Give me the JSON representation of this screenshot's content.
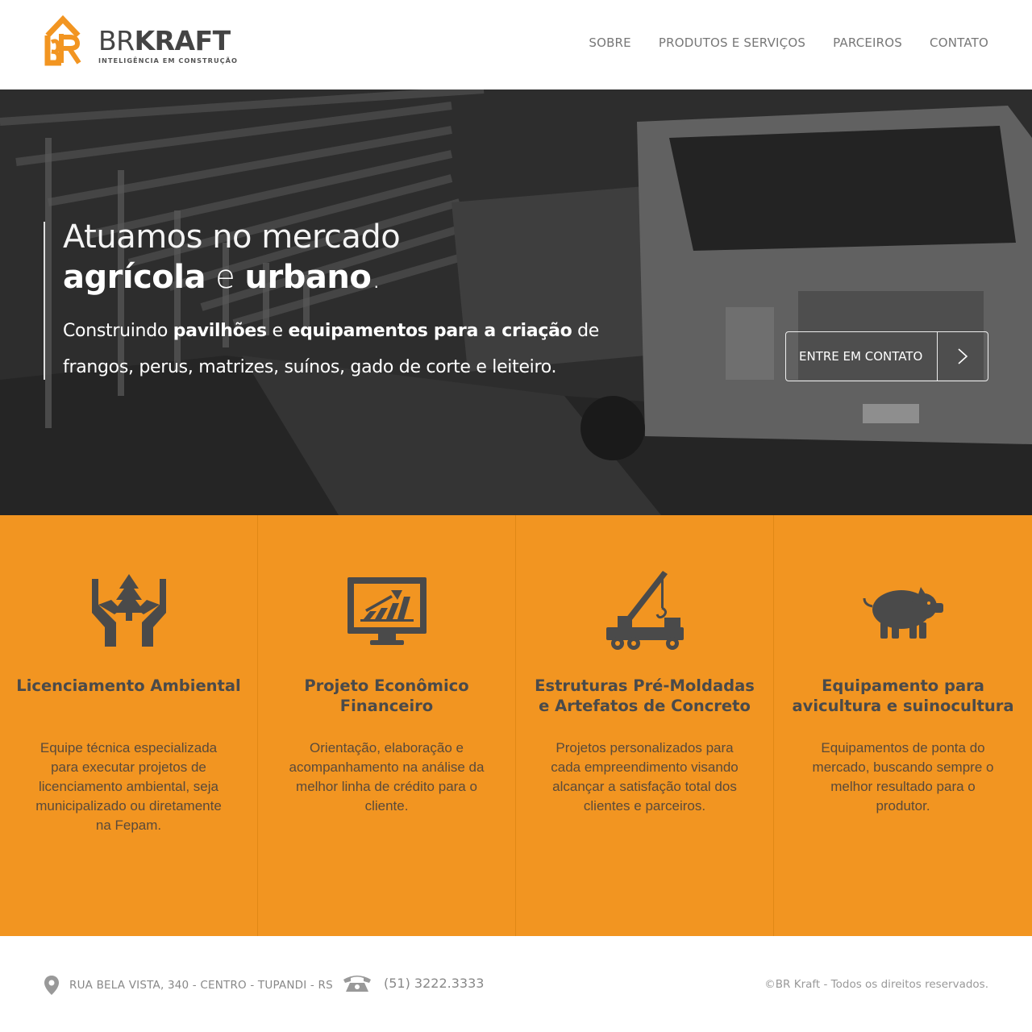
{
  "colors": {
    "accent": "#f29521",
    "icon": "#4a4a4a",
    "text_dark": "#444444"
  },
  "logo": {
    "name_light": "BR",
    "name_bold": "KRAFT",
    "tagline": "INTELIGÊNCIA EM CONSTRUÇÃO"
  },
  "nav": {
    "items": [
      {
        "label": "SOBRE"
      },
      {
        "label": "PRODUTOS E SERVIÇOS"
      },
      {
        "label": "PARCEIROS"
      },
      {
        "label": "CONTATO"
      }
    ]
  },
  "hero": {
    "title_line1": "Atuamos no mercado",
    "title_bold1": "agrícola",
    "title_mid": " e ",
    "title_bold2": "urbano",
    "title_end": ".",
    "sub_pre": "Construindo ",
    "sub_bold1": "pavilhões",
    "sub_mid": " e ",
    "sub_bold2": "equipamentos para a criação",
    "sub_post": " de frangos, perus, matrizes, suínos, gado de corte e leiteiro.",
    "cta_label": "ENTRE EM CONTATO",
    "cta_icon": "chevron-right-icon"
  },
  "features": [
    {
      "icon": "hands-tree-icon",
      "title": "Licenciamento Ambiental",
      "description": "Equipe técnica especializada para executar projetos de licenciamento ambiental, seja municipalizado ou diretamente na Fepam."
    },
    {
      "icon": "monitor-chart-icon",
      "title": "Projeto Econômico Financeiro",
      "description": "Orientação, elaboração e acompanhamento na análise da melhor linha de crédito para o cliente."
    },
    {
      "icon": "crane-truck-icon",
      "title": "Estruturas Pré-Moldadas e Artefatos de Concreto",
      "description": "Projetos personalizados para cada empreendimento visando alcançar a satisfação total dos clientes e parceiros."
    },
    {
      "icon": "pig-icon",
      "title": "Equipamento para avicultura e suinocultura",
      "description": "Equipamentos de ponta do mercado, buscando sempre o melhor resultado para o produtor."
    }
  ],
  "footer": {
    "address": "RUA BELA VISTA, 340 - CENTRO - TUPANDI - RS",
    "phone": "(51) 3222.3333",
    "copyright": "©BR Kraft - Todos os direitos reservados."
  }
}
